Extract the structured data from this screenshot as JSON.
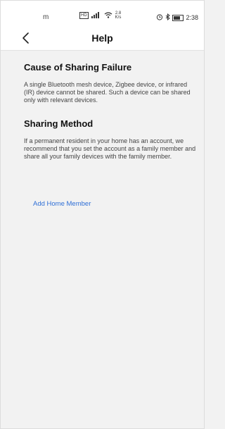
{
  "status_bar": {
    "carrier": "m",
    "hd_badge": "HD",
    "signal_text": "⁴⁶",
    "speed_value": "2.8",
    "speed_unit": "K/s",
    "time": "2:38"
  },
  "header": {
    "title": "Help",
    "back_icon": "chevron-left-icon"
  },
  "sections": [
    {
      "title": "Cause of Sharing Failure",
      "text": "A single Bluetooth mesh device, Zigbee device, or infrared (IR) device cannot be shared. Such a device can be shared only with relevant devices."
    },
    {
      "title": "Sharing Method",
      "text": "If a permanent resident in your home has an account, we recommend that you set the account as a family member and share all your family devices with the family member."
    }
  ],
  "actions": {
    "add_member_label": "Add Home Member"
  },
  "colors": {
    "link": "#2f6fd6",
    "background": "#f2f2f2",
    "header_bg": "#ffffff"
  }
}
